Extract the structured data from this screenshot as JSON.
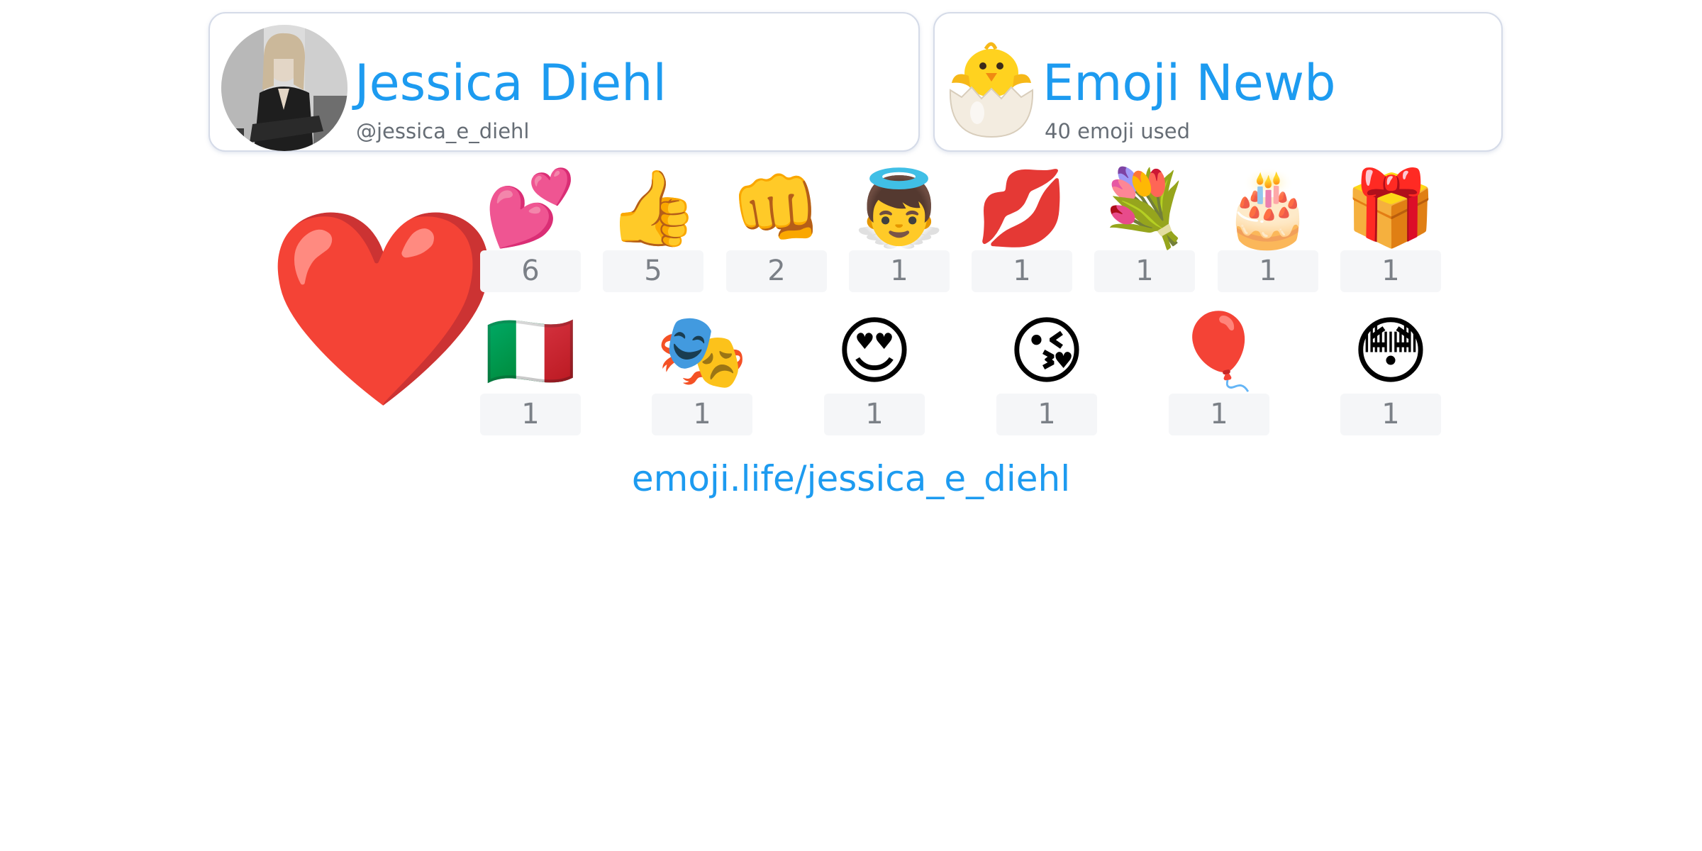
{
  "profile": {
    "name": "Jessica Diehl",
    "handle": "@jessica_e_diehl"
  },
  "rank": {
    "title": "Emoji Newb",
    "emoji_count_text": "40 emoji used",
    "icon": "hatching-chick-icon"
  },
  "top_emoji": {
    "glyph": "❤️",
    "icon": "red-heart-icon"
  },
  "emoji_stats": {
    "row1": [
      {
        "glyph": "💕",
        "icon": "two-hearts-icon",
        "count": "6"
      },
      {
        "glyph": "👍",
        "icon": "thumbs-up-icon",
        "count": "5"
      },
      {
        "glyph": "👊",
        "icon": "oncoming-fist-icon",
        "count": "2"
      },
      {
        "glyph": "👼",
        "icon": "baby-angel-icon",
        "count": "1"
      },
      {
        "glyph": "💋",
        "icon": "kiss-mark-icon",
        "count": "1"
      },
      {
        "glyph": "💐",
        "icon": "bouquet-icon",
        "count": "1"
      },
      {
        "glyph": "🎂",
        "icon": "birthday-cake-icon",
        "count": "1"
      },
      {
        "glyph": "🎁",
        "icon": "wrapped-gift-icon",
        "count": "1"
      }
    ],
    "row2": [
      {
        "glyph": "🇮🇹",
        "icon": "italy-flag-icon",
        "count": "1"
      },
      {
        "glyph": "🎭",
        "icon": "performing-arts-icon",
        "count": "1"
      },
      {
        "glyph": "😍",
        "icon": "heart-eyes-face-icon",
        "count": "1"
      },
      {
        "glyph": "😘",
        "icon": "face-blowing-kiss-icon",
        "count": "1"
      },
      {
        "glyph": "🎈",
        "icon": "balloon-icon",
        "count": "1"
      },
      {
        "glyph": "😳",
        "icon": "flushed-face-icon",
        "count": "1"
      }
    ]
  },
  "footer": {
    "link_text": "emoji.life/jessica_e_diehl"
  }
}
